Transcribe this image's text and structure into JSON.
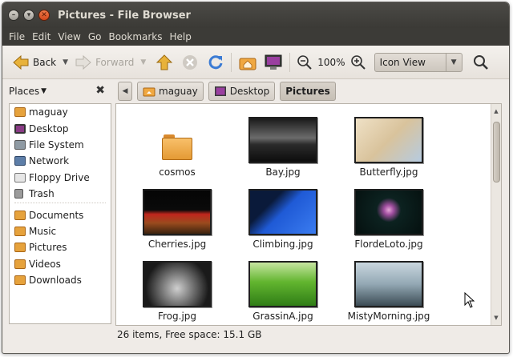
{
  "window": {
    "title": "Pictures - File Browser"
  },
  "menu": [
    "File",
    "Edit",
    "View",
    "Go",
    "Bookmarks",
    "Help"
  ],
  "toolbar": {
    "back_label": "Back",
    "forward_label": "Forward",
    "zoom_level": "100%",
    "view_mode": "Icon View"
  },
  "sidepane": {
    "header": "Places",
    "items": [
      {
        "label": "maguay",
        "icon": "home-icon",
        "color": "#e6a23c"
      },
      {
        "label": "Desktop",
        "icon": "desktop-icon",
        "color": "#8a3b86"
      },
      {
        "label": "File System",
        "icon": "filesystem-icon",
        "color": "#8f9aa3"
      },
      {
        "label": "Network",
        "icon": "network-icon",
        "color": "#5d7ea8"
      },
      {
        "label": "Floppy Drive",
        "icon": "floppy-icon",
        "color": "#c8c8c8"
      },
      {
        "label": "Trash",
        "icon": "trash-icon",
        "color": "#9b9b9b"
      }
    ],
    "bookmarks": [
      {
        "label": "Documents",
        "icon": "folder-icon",
        "color": "#e6a23c"
      },
      {
        "label": "Music",
        "icon": "music-folder-icon",
        "color": "#e6a23c"
      },
      {
        "label": "Pictures",
        "icon": "pictures-folder-icon",
        "color": "#e6a23c"
      },
      {
        "label": "Videos",
        "icon": "videos-folder-icon",
        "color": "#e6a23c"
      },
      {
        "label": "Downloads",
        "icon": "downloads-folder-icon",
        "color": "#e6a23c"
      }
    ]
  },
  "pathbar": [
    "maguay",
    "Desktop",
    "Pictures"
  ],
  "files": [
    {
      "name": "cosmos",
      "kind": "folder"
    },
    {
      "name": "Bay.jpg",
      "kind": "image",
      "bg": "linear-gradient(#1a1a1a 0%, #6b6b6b 45%, #2b2b2b 60%, #0d0d0d 100%)"
    },
    {
      "name": "Butterfly.jpg",
      "kind": "image",
      "bg": "linear-gradient(135deg, #efe1c6 0%, #d9c39c 50%, #b6cbe0 100%)"
    },
    {
      "name": "Cherries.jpg",
      "kind": "image",
      "bg": "linear-gradient(#050505 0%, #0a0a0a 45%, #c0261d 55%, #9a4b1e 75%, #3c230f 100%)"
    },
    {
      "name": "Climbing.jpg",
      "kind": "image",
      "bg": "linear-gradient(135deg, #0a1a3a 0%, #0a1a3a 30%, #1f5ad6 50%, #3b7cf0 100%)"
    },
    {
      "name": "FlordeLoto.jpg",
      "kind": "image",
      "bg": "radial-gradient(circle at 50% 45%, #e6a7d8 0%, #a04e9f 12%, #0c2220 30%, #05100f 100%)"
    },
    {
      "name": "Frog.jpg",
      "kind": "image",
      "bg": "radial-gradient(circle at 50% 60%, #cfcfcf 0%, #7a7a7a 35%, #1a1a1a 75%)"
    },
    {
      "name": "GrassinA.jpg",
      "kind": "image",
      "bg": "linear-gradient(#c6e4a0 0%, #62b52f 45%, #2f7d16 100%)"
    },
    {
      "name": "MistyMorning.jpg",
      "kind": "image",
      "bg": "linear-gradient(#c9d6de 0%, #93a8b4 50%, #3c4c55 100%)"
    }
  ],
  "status": "26 items, Free space: 15.1 GB"
}
